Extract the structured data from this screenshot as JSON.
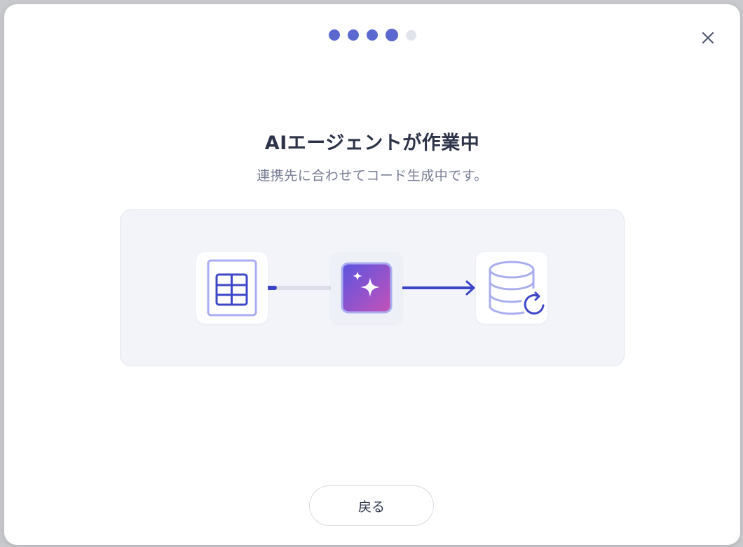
{
  "stepper": {
    "total": 5,
    "current": 4
  },
  "dialog": {
    "title": "AIエージェントが作業中",
    "subtitle": "連携先に合わせてコード生成中です。",
    "back_label": "戻る"
  },
  "flow": {
    "nodes": [
      {
        "name": "spreadsheet",
        "icon": "table-icon"
      },
      {
        "name": "ai-agent",
        "icon": "sparkles-icon"
      },
      {
        "name": "database",
        "icon": "database-sync-icon"
      }
    ]
  },
  "colors": {
    "accent": "#5b68cf",
    "accent_dark": "#3a44c6",
    "icon_light": "#a9aef0",
    "ai_gradient_start": "#5a54e0",
    "ai_gradient_end": "#c552b8",
    "panel_bg": "#f3f4f9"
  }
}
